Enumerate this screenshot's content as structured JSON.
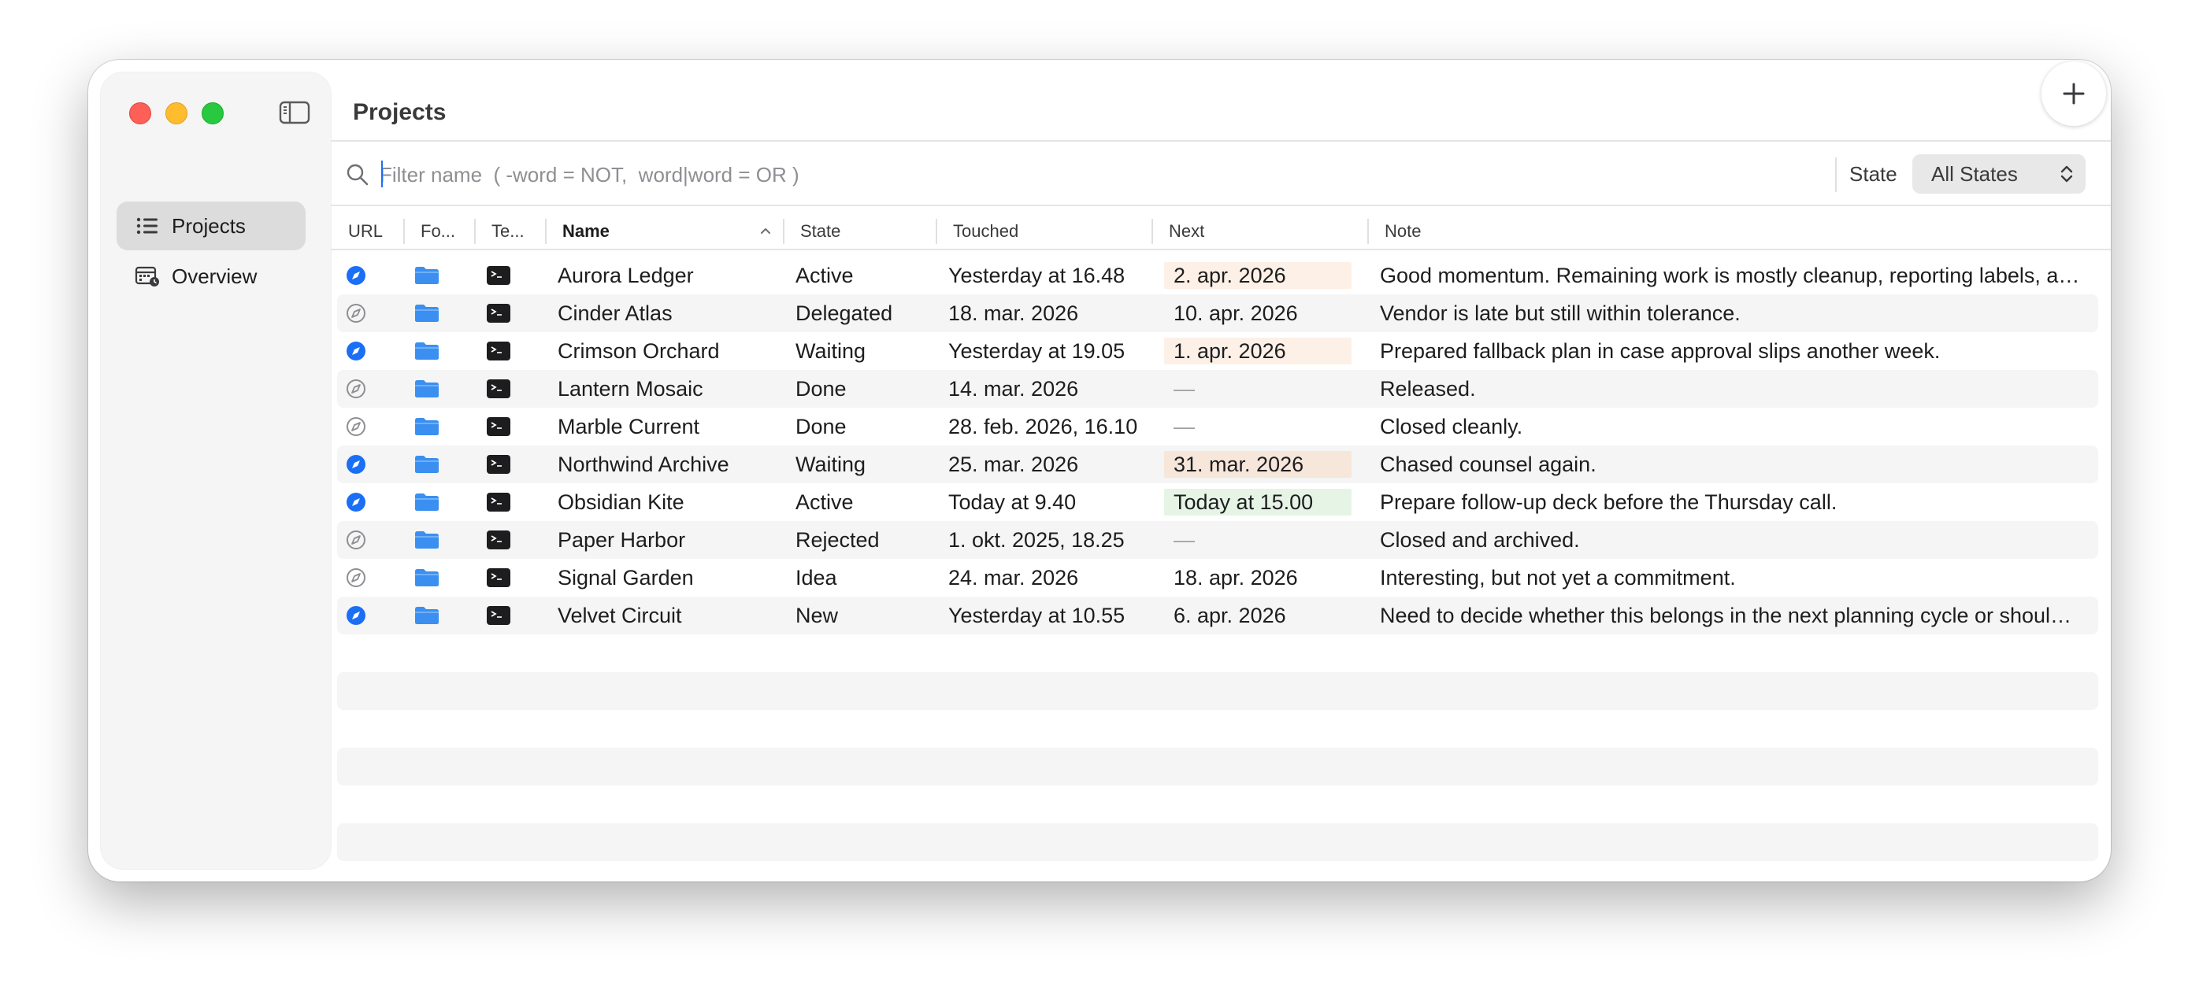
{
  "window": {
    "title": "Projects"
  },
  "sidebar": {
    "items": [
      {
        "label": "Projects",
        "icon": "list-icon",
        "selected": true
      },
      {
        "label": "Overview",
        "icon": "calendar-icon",
        "selected": false
      }
    ]
  },
  "filter": {
    "placeholder": "Filter name  ( -word = NOT,  word|word = OR )",
    "value": ""
  },
  "state_filter": {
    "label": "State",
    "value": "All States"
  },
  "table": {
    "columns": [
      "URL",
      "Fo...",
      "Te...",
      "Name",
      "State",
      "Touched",
      "Next",
      "Note"
    ],
    "sort_column": "Name",
    "sort_direction": "ascending",
    "rows": [
      {
        "url_active": true,
        "name": "Aurora Ledger",
        "state": "Active",
        "touched": "Yesterday at 16.48",
        "next": "2. apr. 2026",
        "next_highlight": "#fdf0e6",
        "note": "Good momentum. Remaining work is mostly cleanup, reporting labels, and final documentation."
      },
      {
        "url_active": false,
        "name": "Cinder Atlas",
        "state": "Delegated",
        "touched": "18. mar. 2026",
        "next": "10. apr. 2026",
        "next_highlight": "",
        "note": "Vendor is late but still within tolerance."
      },
      {
        "url_active": true,
        "name": "Crimson Orchard",
        "state": "Waiting",
        "touched": "Yesterday at 19.05",
        "next": "1. apr. 2026",
        "next_highlight": "#fdf0e6",
        "note": "Prepared fallback plan in case approval slips another week."
      },
      {
        "url_active": false,
        "name": "Lantern Mosaic",
        "state": "Done",
        "touched": "14. mar. 2026",
        "next": "—",
        "next_highlight": "",
        "note": "Released."
      },
      {
        "url_active": false,
        "name": "Marble Current",
        "state": "Done",
        "touched": "28. feb. 2026, 16.10",
        "next": "—",
        "next_highlight": "",
        "note": "Closed cleanly."
      },
      {
        "url_active": true,
        "name": "Northwind Archive",
        "state": "Waiting",
        "touched": "25. mar. 2026",
        "next": "31. mar. 2026",
        "next_highlight": "#f7e6da",
        "note": "Chased counsel again."
      },
      {
        "url_active": true,
        "name": "Obsidian Kite",
        "state": "Active",
        "touched": "Today at 9.40",
        "next": "Today at 15.00",
        "next_highlight": "#e6f4e6",
        "note": "Prepare follow-up deck before the Thursday call."
      },
      {
        "url_active": false,
        "name": "Paper Harbor",
        "state": "Rejected",
        "touched": "1. okt. 2025, 18.25",
        "next": "—",
        "next_highlight": "",
        "note": "Closed and archived."
      },
      {
        "url_active": false,
        "name": "Signal Garden",
        "state": "Idea",
        "touched": "24. mar. 2026",
        "next": "18. apr. 2026",
        "next_highlight": "",
        "note": "Interesting, but not yet a commitment."
      },
      {
        "url_active": true,
        "name": "Velvet Circuit",
        "state": "New",
        "touched": "Yesterday at 10.55",
        "next": "6. apr. 2026",
        "next_highlight": "",
        "note": "Need to decide whether this belongs in the next planning cycle or should be parked."
      }
    ]
  },
  "colors": {
    "accent": "#1a6ff5",
    "compass_active": "#1a6ff5",
    "compass_inactive": "#8e8e93",
    "folder": "#3b8ff0",
    "terminal": "#1d1d1f",
    "row_stripe": "#f4f5f4"
  }
}
